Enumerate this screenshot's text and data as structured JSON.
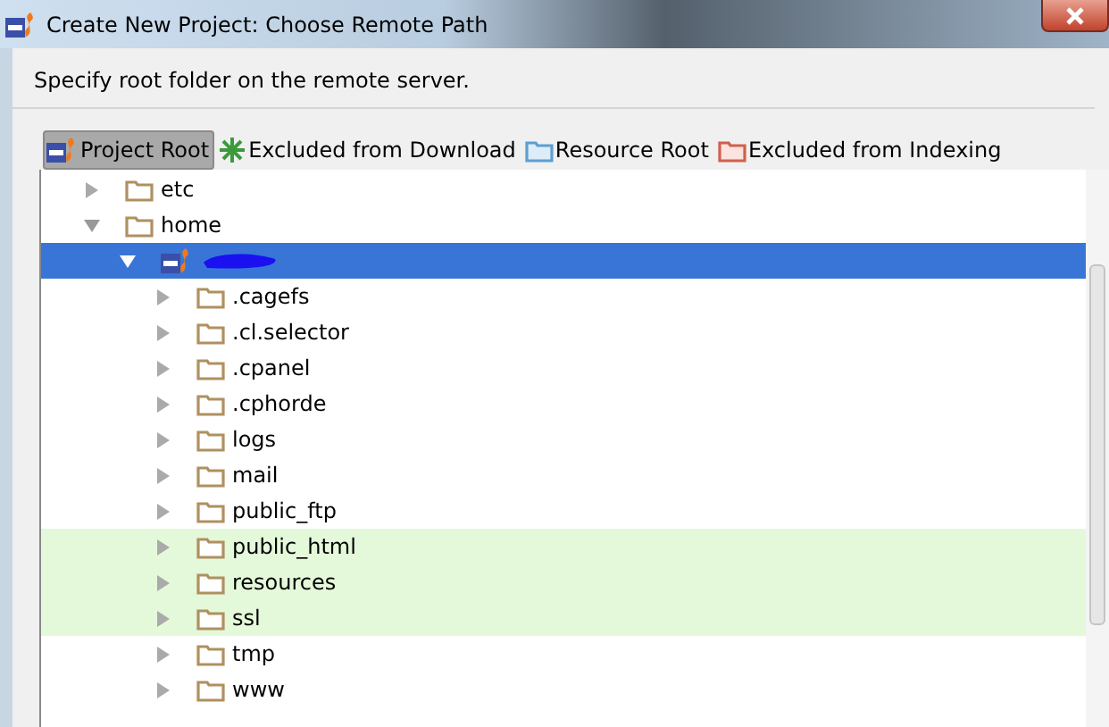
{
  "window": {
    "title": "Create New Project: Choose Remote Path"
  },
  "description": "Specify root folder on the remote server.",
  "toolbar": [
    {
      "kind": "project",
      "label": "Project Root",
      "selected": true
    },
    {
      "kind": "excluded-download",
      "label": "Excluded from Download",
      "selected": false
    },
    {
      "kind": "resource",
      "label": "Resource Root",
      "selected": false
    },
    {
      "kind": "excluded-indexing",
      "label": "Excluded from Indexing",
      "selected": false
    }
  ],
  "tree": [
    {
      "kind": "folder",
      "label": "etc",
      "expanded": false,
      "selected": false,
      "highlighted": false
    },
    {
      "kind": "folder",
      "label": "home",
      "expanded": true,
      "selected": false,
      "highlighted": false,
      "children": [
        {
          "kind": "project",
          "expanded": true,
          "selected": true,
          "children": [
            {
              "kind": "folder",
              "label": ".cagefs",
              "expanded": false,
              "selected": false,
              "highlighted": false
            },
            {
              "kind": "folder",
              "label": ".cl.selector",
              "expanded": false,
              "selected": false,
              "highlighted": false
            },
            {
              "kind": "folder",
              "label": ".cpanel",
              "expanded": false,
              "selected": false,
              "highlighted": false
            },
            {
              "kind": "folder",
              "label": ".cphorde",
              "expanded": false,
              "selected": false,
              "highlighted": false
            },
            {
              "kind": "folder",
              "label": "logs",
              "expanded": false,
              "selected": false,
              "highlighted": false
            },
            {
              "kind": "folder",
              "label": "mail",
              "expanded": false,
              "selected": false,
              "highlighted": false
            },
            {
              "kind": "folder",
              "label": "public_ftp",
              "expanded": false,
              "selected": false,
              "highlighted": false
            },
            {
              "kind": "folder",
              "label": "public_html",
              "expanded": false,
              "selected": false,
              "highlighted": true
            },
            {
              "kind": "folder",
              "label": "resources",
              "expanded": false,
              "selected": false,
              "highlighted": true
            },
            {
              "kind": "folder",
              "label": "ssl",
              "expanded": false,
              "selected": false,
              "highlighted": true
            },
            {
              "kind": "folder",
              "label": "tmp",
              "expanded": false,
              "selected": false,
              "highlighted": false
            },
            {
              "kind": "folder",
              "label": "www",
              "expanded": false,
              "selected": false,
              "highlighted": false
            }
          ]
        }
      ]
    }
  ]
}
